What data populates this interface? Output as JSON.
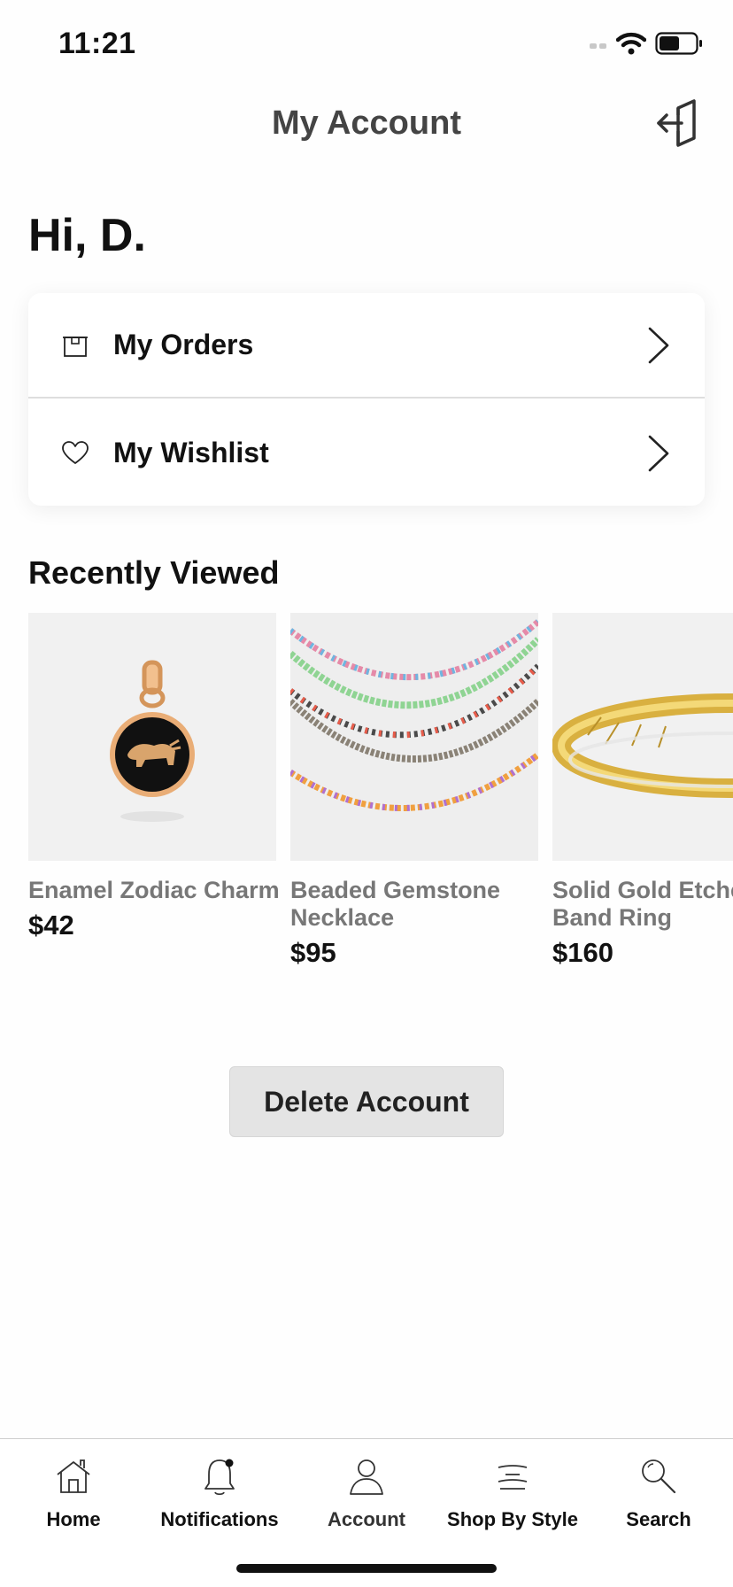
{
  "status_bar": {
    "time": "11:21"
  },
  "header": {
    "title": "My Account"
  },
  "greeting": "Hi,  D.",
  "menu": [
    {
      "label": "My Orders",
      "icon": "box-icon"
    },
    {
      "label": "My Wishlist",
      "icon": "heart-icon"
    }
  ],
  "recently_viewed": {
    "title": "Recently Viewed",
    "products": [
      {
        "name": "Enamel Zodiac Charm",
        "price": "$42"
      },
      {
        "name": "Beaded Gemstone\nNecklace",
        "price": "$95"
      },
      {
        "name": "Solid Gold Etched\nBand Ring",
        "price": "$160"
      }
    ]
  },
  "delete_button": "Delete Account",
  "tabs": [
    {
      "label": "Home",
      "icon": "home-icon"
    },
    {
      "label": "Notifications",
      "icon": "bell-icon"
    },
    {
      "label": "Account",
      "icon": "user-icon"
    },
    {
      "label": "Shop By Style",
      "icon": "style-lines-icon"
    },
    {
      "label": "Search",
      "icon": "search-icon"
    }
  ],
  "colors": {
    "accent": "#111111",
    "muted": "#777777",
    "button_bg": "#e4e4e4"
  }
}
